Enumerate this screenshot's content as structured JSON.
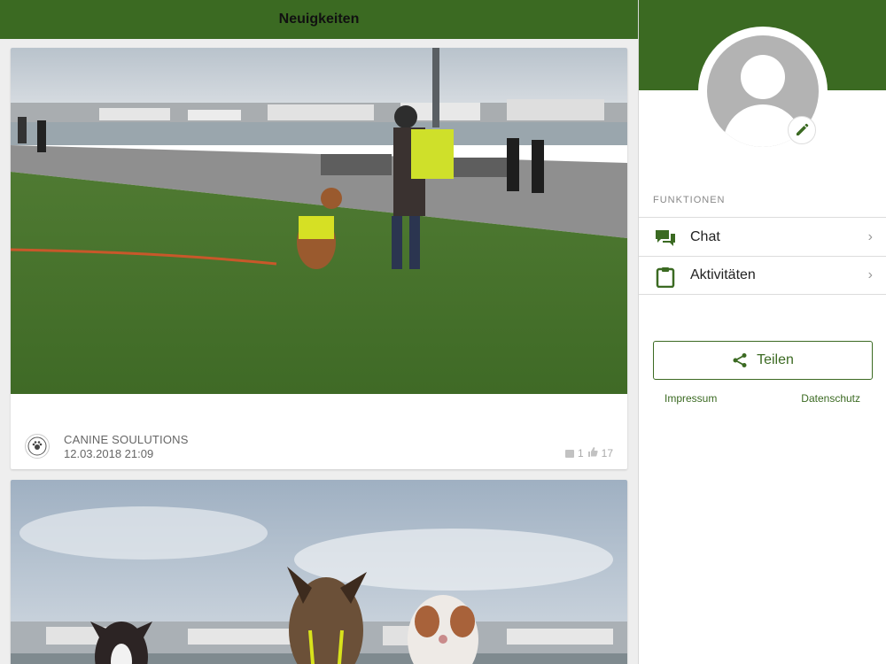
{
  "header": {
    "title": "Neuigkeiten"
  },
  "posts": [
    {
      "author": "CANINE SOULUTIONS",
      "date": "12.03.2018 21:09",
      "comments": "1",
      "likes": "17",
      "image": "photo-dog-training-riverside"
    },
    {
      "image": "photo-three-dogs-riverside"
    }
  ],
  "sidebar": {
    "section_label": "FUNKTIONEN",
    "items": [
      {
        "label": "Chat",
        "icon": "chat-icon"
      },
      {
        "label": "Aktivitäten",
        "icon": "clipboard-icon"
      }
    ],
    "share_label": "Teilen",
    "impressum": "Impressum",
    "datenschutz": "Datenschutz"
  },
  "colors": {
    "brand": "#3b6a22",
    "background": "#eeeeee"
  }
}
